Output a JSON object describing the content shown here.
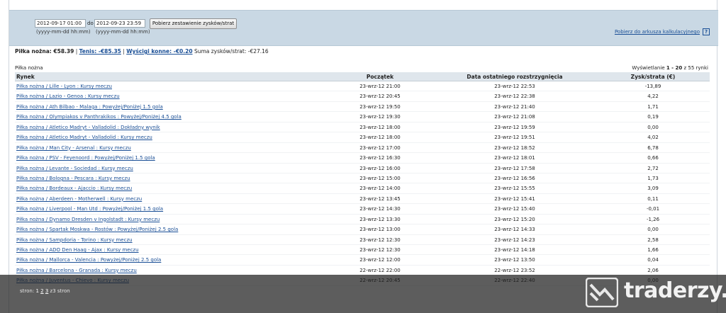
{
  "filter": {
    "date_from": "2012-09-17 01:00",
    "date_to": "2012-09-23 23:59",
    "to_label": "do",
    "format_hint_from": "(yyyy-mm-dd hh:mm)",
    "format_hint_to": "(yyyy-mm-dd hh:mm)",
    "fetch_button": "Pobierz zestawienie zysków/strat",
    "calc_link": "Pobierz do arkusza kalkulacyjnego",
    "help_label": "?"
  },
  "summary": {
    "football_label": "Piłka nożna: €58.39",
    "sep1": "|",
    "tennis_link": "Tenis: -€85.35",
    "sep2": "|",
    "racing_link": "Wyścigi konne: -€0.20",
    "total_label": "Suma zysków/strat:",
    "total_value": "-€27.16"
  },
  "section_title": "Piłka nożna",
  "showing": {
    "prefix": "Wyświetlanie",
    "range": "1 - 20",
    "suffix": "z 55 rynki"
  },
  "table": {
    "headers": [
      "Rynek",
      "Początek",
      "Data ostatniego rozstrzygnięcia",
      "Zysk/strata (€)"
    ],
    "rows": [
      {
        "market": "Piłka nożna / Lille - Lyon : Kursy meczu",
        "start": "23-wrz-12 21:00",
        "settled": "23-wrz-12 22:53",
        "pl": "-13,89"
      },
      {
        "market": "Piłka nożna / Lazio - Genoa : Kursy meczu",
        "start": "23-wrz-12 20:45",
        "settled": "23-wrz-12 22:38",
        "pl": "4,22"
      },
      {
        "market": "Piłka nożna / Ath Bilbao - Malaga : Powyżej/Poniżej 1.5 gola",
        "start": "23-wrz-12 19:50",
        "settled": "23-wrz-12 21:40",
        "pl": "1,71"
      },
      {
        "market": "Piłka nożna / Olympiakos v Panthrakikos : Powyżej/Poniżej 4.5 gola",
        "start": "23-wrz-12 19:30",
        "settled": "23-wrz-12 21:08",
        "pl": "0,19"
      },
      {
        "market": "Piłka nożna / Atletico Madryt - Valladolid : Dokładny wynik",
        "start": "23-wrz-12 18:00",
        "settled": "23-wrz-12 19:59",
        "pl": "0,00"
      },
      {
        "market": "Piłka nożna / Atletico Madryt - Valladolid : Kursy meczu",
        "start": "23-wrz-12 18:00",
        "settled": "23-wrz-12 19:51",
        "pl": "4,02"
      },
      {
        "market": "Piłka nożna / Man City - Arsenal : Kursy meczu",
        "start": "23-wrz-12 17:00",
        "settled": "23-wrz-12 18:52",
        "pl": "6,78"
      },
      {
        "market": "Piłka nożna / PSV - Feyenoord : Powyżej/Poniżej 1.5 gola",
        "start": "23-wrz-12 16:30",
        "settled": "23-wrz-12 18:01",
        "pl": "0,66"
      },
      {
        "market": "Piłka nożna / Levante - Sociedad : Kursy meczu",
        "start": "23-wrz-12 16:00",
        "settled": "23-wrz-12 17:58",
        "pl": "2,72"
      },
      {
        "market": "Piłka nożna / Bologna - Pescara : Kursy meczu",
        "start": "23-wrz-12 15:00",
        "settled": "23-wrz-12 16:56",
        "pl": "1,73"
      },
      {
        "market": "Piłka nożna / Bordeaux - Ajaccio : Kursy meczu",
        "start": "23-wrz-12 14:00",
        "settled": "23-wrz-12 15:55",
        "pl": "3,09"
      },
      {
        "market": "Piłka nożna / Aberdeen - Motherwell : Kursy meczu",
        "start": "23-wrz-12 13:45",
        "settled": "23-wrz-12 15:41",
        "pl": "0,11"
      },
      {
        "market": "Piłka nożna / Liverpool - Man Utd : Powyżej/Poniżej 1.5 gola",
        "start": "23-wrz-12 14:30",
        "settled": "23-wrz-12 15:40",
        "pl": "-0,01"
      },
      {
        "market": "Piłka nożna / Dynamo Dresden v Ingolstadt : Kursy meczu",
        "start": "23-wrz-12 13:30",
        "settled": "23-wrz-12 15:20",
        "pl": "-1,26"
      },
      {
        "market": "Piłka nożna / Spartak Moskwa - Rostów : Powyżej/Poniżej 2.5 gola",
        "start": "23-wrz-12 13:00",
        "settled": "23-wrz-12 14:33",
        "pl": "0,00"
      },
      {
        "market": "Piłka nożna / Sampdoria - Torino : Kursy meczu",
        "start": "23-wrz-12 12:30",
        "settled": "23-wrz-12 14:23",
        "pl": "2,58"
      },
      {
        "market": "Piłka nożna / ADO Den Haag - Ajax : Kursy meczu",
        "start": "23-wrz-12 12:30",
        "settled": "23-wrz-12 14:18",
        "pl": "1,66"
      },
      {
        "market": "Piłka nożna / Mallorca - Valencia : Powyżej/Poniżej 2.5 gola",
        "start": "23-wrz-12 12:00",
        "settled": "23-wrz-12 13:50",
        "pl": "0,04"
      },
      {
        "market": "Piłka nożna / Barcelona - Granada : Kursy meczu",
        "start": "22-wrz-12 22:00",
        "settled": "22-wrz-12 23:52",
        "pl": "2,06"
      },
      {
        "market": "Piłka nożna / Juventus - Chievo : Kursy meczu",
        "start": "22-wrz-12 20:45",
        "settled": "22-wrz-12 22:40",
        "pl": "0,00"
      }
    ]
  },
  "pager": {
    "label": "stron:",
    "current": "1",
    "page2": "2",
    "page3": "3",
    "total": "z3 stron"
  },
  "watermark": {
    "text": "traderzy.pl",
    "icon": "traderzy-logo-icon"
  }
}
